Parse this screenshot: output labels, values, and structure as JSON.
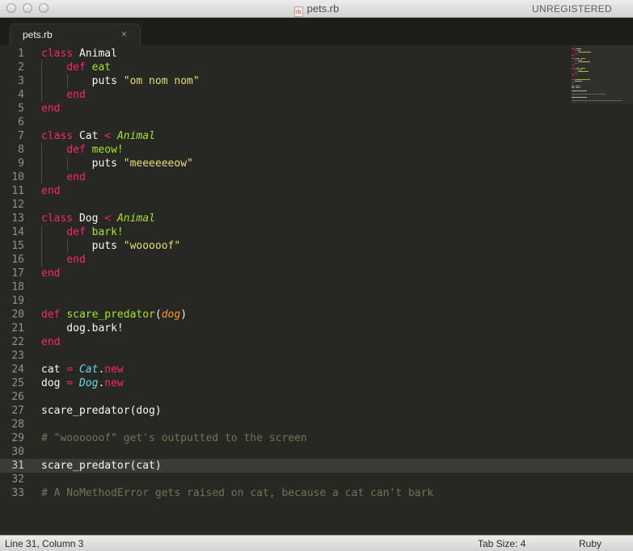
{
  "window": {
    "title": "pets.rb",
    "file_badge": "rb",
    "unregistered": "UNREGISTERED"
  },
  "tab": {
    "label": "pets.rb",
    "close": "×"
  },
  "editor": {
    "current_line": 31,
    "lines": [
      {
        "n": "1",
        "t": [
          [
            "k",
            "class"
          ],
          [
            "w",
            " Animal"
          ]
        ]
      },
      {
        "n": "2",
        "indent": 1,
        "t": [
          [
            "w",
            "    "
          ],
          [
            "k",
            "def"
          ],
          [
            "w",
            " "
          ],
          [
            "f",
            "eat"
          ]
        ]
      },
      {
        "n": "3",
        "indent": 2,
        "t": [
          [
            "w",
            "        puts "
          ],
          [
            "s",
            "\"om nom nom\""
          ]
        ]
      },
      {
        "n": "4",
        "indent": 1,
        "t": [
          [
            "w",
            "    "
          ],
          [
            "k",
            "end"
          ]
        ]
      },
      {
        "n": "5",
        "t": [
          [
            "k",
            "end"
          ]
        ]
      },
      {
        "n": "6",
        "t": []
      },
      {
        "n": "7",
        "t": [
          [
            "k",
            "class"
          ],
          [
            "w",
            " Cat "
          ],
          [
            "k",
            "<"
          ],
          [
            "w",
            " "
          ],
          [
            "i",
            "Animal"
          ]
        ]
      },
      {
        "n": "8",
        "indent": 1,
        "t": [
          [
            "w",
            "    "
          ],
          [
            "k",
            "def"
          ],
          [
            "w",
            " "
          ],
          [
            "f",
            "meow!"
          ]
        ]
      },
      {
        "n": "9",
        "indent": 2,
        "t": [
          [
            "w",
            "        puts "
          ],
          [
            "s",
            "\"meeeeeeow\""
          ]
        ]
      },
      {
        "n": "10",
        "indent": 1,
        "t": [
          [
            "w",
            "    "
          ],
          [
            "k",
            "end"
          ]
        ]
      },
      {
        "n": "11",
        "t": [
          [
            "k",
            "end"
          ]
        ]
      },
      {
        "n": "12",
        "t": []
      },
      {
        "n": "13",
        "t": [
          [
            "k",
            "class"
          ],
          [
            "w",
            " Dog "
          ],
          [
            "k",
            "<"
          ],
          [
            "w",
            " "
          ],
          [
            "i",
            "Animal"
          ]
        ]
      },
      {
        "n": "14",
        "indent": 1,
        "t": [
          [
            "w",
            "    "
          ],
          [
            "k",
            "def"
          ],
          [
            "w",
            " "
          ],
          [
            "f",
            "bark!"
          ]
        ]
      },
      {
        "n": "15",
        "indent": 2,
        "t": [
          [
            "w",
            "        puts "
          ],
          [
            "s",
            "\"wooooof\""
          ]
        ]
      },
      {
        "n": "16",
        "indent": 1,
        "t": [
          [
            "w",
            "    "
          ],
          [
            "k",
            "end"
          ]
        ]
      },
      {
        "n": "17",
        "t": [
          [
            "k",
            "end"
          ]
        ]
      },
      {
        "n": "18",
        "t": []
      },
      {
        "n": "19",
        "t": []
      },
      {
        "n": "20",
        "t": [
          [
            "k",
            "def"
          ],
          [
            "w",
            " "
          ],
          [
            "f",
            "scare_predator"
          ],
          [
            "w",
            "("
          ],
          [
            "p",
            "dog"
          ],
          [
            "w",
            ")"
          ]
        ]
      },
      {
        "n": "21",
        "t": [
          [
            "w",
            "    dog.bark!"
          ]
        ]
      },
      {
        "n": "22",
        "t": [
          [
            "k",
            "end"
          ]
        ]
      },
      {
        "n": "23",
        "t": []
      },
      {
        "n": "24",
        "t": [
          [
            "w",
            "cat "
          ],
          [
            "k",
            "="
          ],
          [
            "w",
            " "
          ],
          [
            "cl",
            "Cat"
          ],
          [
            "w",
            "."
          ],
          [
            "k",
            "new"
          ]
        ]
      },
      {
        "n": "25",
        "t": [
          [
            "w",
            "dog "
          ],
          [
            "k",
            "="
          ],
          [
            "w",
            " "
          ],
          [
            "cl",
            "Dog"
          ],
          [
            "w",
            "."
          ],
          [
            "k",
            "new"
          ]
        ]
      },
      {
        "n": "26",
        "t": []
      },
      {
        "n": "27",
        "t": [
          [
            "w",
            "scare_predator(dog)"
          ]
        ]
      },
      {
        "n": "28",
        "t": []
      },
      {
        "n": "29",
        "t": [
          [
            "c",
            "# \"woooooof\" get's outputted to the screen"
          ]
        ]
      },
      {
        "n": "30",
        "t": []
      },
      {
        "n": "31",
        "t": [
          [
            "w",
            "scare_predator(cat)"
          ]
        ]
      },
      {
        "n": "32",
        "t": []
      },
      {
        "n": "33",
        "t": [
          [
            "c",
            "# A NoMethodError gets raised on cat, because a cat can't bark"
          ]
        ]
      }
    ]
  },
  "status": {
    "position": "Line 31, Column 3",
    "tab_size": "Tab Size: 4",
    "syntax": "Ruby"
  },
  "colors": {
    "background": "#272822",
    "keyword": "#f92672",
    "function": "#a6e22e",
    "string": "#e6db74",
    "comment": "#75715e",
    "class_ref": "#66d9ef",
    "parameter": "#fd971f"
  }
}
